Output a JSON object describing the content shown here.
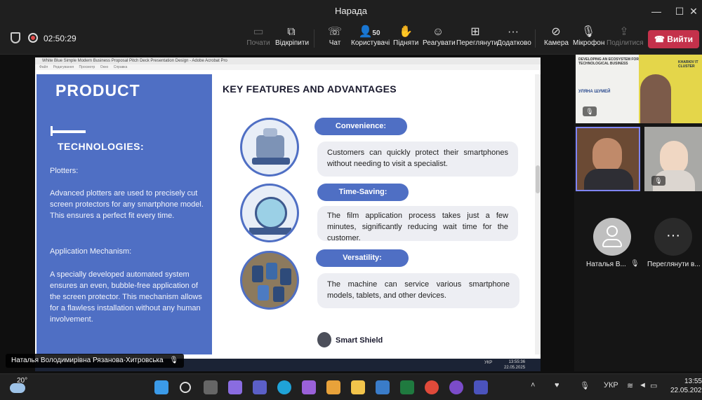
{
  "window": {
    "title": "Нарада"
  },
  "toolbar": {
    "timer": "02:50:29",
    "start": "Почати",
    "detach": "Відкріпити",
    "chat": "Чат",
    "people_count": "50",
    "people": "Користувачі",
    "raise": "Підняти",
    "react": "Реагувати",
    "view": "Переглянути",
    "more": "Додатково",
    "camera": "Камера",
    "mic": "Мікрофон",
    "share": "Поділитися",
    "leave": "Вийти"
  },
  "shared_window": {
    "title": "White Blue Simple Modern Business Proposal Pitch Deck Presentation Design - Adobe Acrobat Pro",
    "menu": "Файл Редагування Просмотр Окно Справка"
  },
  "slide": {
    "left": {
      "title": "PRODUCT",
      "subtitle": "TECHNOLOGIES:",
      "p1_head": "Plotters:",
      "p1": "Advanced plotters are used to precisely cut screen protectors for any smartphone model. This ensures a perfect fit every time.",
      "p2_head": "Application Mechanism:",
      "p2": " A specially developed automated system ensures an even, bubble-free application of the screen protector. This mechanism allows for a flawless installation without any human involvement."
    },
    "right": {
      "title": "KEY FEATURES AND ADVANTAGES",
      "features": [
        {
          "label": "Convenience:",
          "text": "Customers can quickly protect their smartphones without needing to visit a specialist."
        },
        {
          "label": "Time-Saving:",
          "text": "The film application process takes just a few minutes, significantly reducing wait time for the customer."
        },
        {
          "label": "Versatility:",
          "text": "The machine can service various smartphone models, tablets, and other devices."
        }
      ],
      "brand": "Smart Shield"
    },
    "inner_clock": {
      "time": "13:55:36",
      "date": "22.05.2025",
      "lang": "УКР"
    }
  },
  "participants": {
    "tile1_name": "УЛЯНА ШУМЕЙ",
    "tile1_banner": "DEVELOPING AN ECOSYSTEM FOR TECHNOLOGICAL BUSINESS",
    "tile1_logo": "KHARKIV IT CLUSTER",
    "person_a": "Наталья В...",
    "more": "Переглянути в..."
  },
  "presenter": {
    "name": "Наталья Володимирівна Рязанова-Хитровська"
  },
  "taskbar": {
    "weather": "20°",
    "lang": "УКР",
    "time": "13:55",
    "date": "22.05.2025"
  }
}
